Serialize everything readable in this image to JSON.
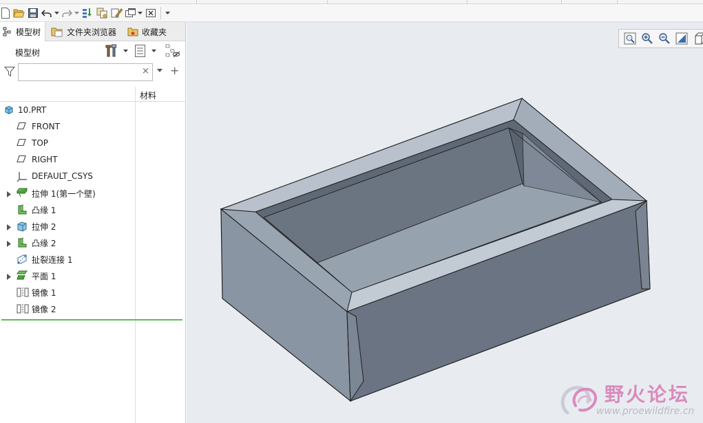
{
  "colors": {
    "accent_green": "#5cb85c",
    "model_fill": "#7f8a98",
    "model_dark": "#5d6673",
    "model_light": "#a9b3bf",
    "background": "#e8ecf0"
  },
  "toolbar": {
    "icons": [
      "new-file-icon",
      "open-folder-icon",
      "save-icon",
      "undo-icon",
      "redo-icon",
      "regenerate-icon",
      "copy-icon",
      "edit-icon",
      "window-icon",
      "close-window-icon",
      "customize-icon"
    ]
  },
  "left_panel": {
    "tabs": [
      {
        "label": "模型树",
        "icon": "model-tree-icon"
      },
      {
        "label": "文件夹浏览器",
        "icon": "folder-browser-icon"
      },
      {
        "label": "收藏夹",
        "icon": "favorites-icon"
      }
    ],
    "tree_title": "模型树",
    "search": {
      "value": "",
      "placeholder": ""
    },
    "clear_symbol": "×",
    "add_symbol": "+",
    "column_material": "材料",
    "tree_items": [
      {
        "label": "10.PRT",
        "icon": "part-icon",
        "expandable": false,
        "indent": 0
      },
      {
        "label": "FRONT",
        "icon": "datum-plane-icon",
        "expandable": false,
        "indent": 1
      },
      {
        "label": "TOP",
        "icon": "datum-plane-icon",
        "expandable": false,
        "indent": 1
      },
      {
        "label": "RIGHT",
        "icon": "datum-plane-icon",
        "expandable": false,
        "indent": 1
      },
      {
        "label": "DEFAULT_CSYS",
        "icon": "csys-icon",
        "expandable": false,
        "indent": 1
      },
      {
        "label": "拉伸 1(第一个壁)",
        "icon": "sheetmetal-extrude-icon",
        "expandable": true,
        "indent": 1
      },
      {
        "label": "凸缘 1",
        "icon": "flange-icon",
        "expandable": false,
        "indent": 1
      },
      {
        "label": "拉伸 2",
        "icon": "extrude-icon",
        "expandable": true,
        "indent": 1
      },
      {
        "label": "凸缘 2",
        "icon": "flange-icon",
        "expandable": true,
        "indent": 1
      },
      {
        "label": "扯裂连接 1",
        "icon": "rip-icon",
        "expandable": false,
        "indent": 1
      },
      {
        "label": "平面 1",
        "icon": "flat-wall-icon",
        "expandable": true,
        "indent": 1
      },
      {
        "label": "镜像 1",
        "icon": "mirror-icon",
        "expandable": false,
        "indent": 1
      },
      {
        "label": "镜像 2",
        "icon": "mirror-icon",
        "expandable": false,
        "indent": 1
      }
    ]
  },
  "view_toolbar": {
    "icons": [
      "zoom-refit-icon",
      "zoom-in-icon",
      "zoom-out-icon",
      "repaint-icon",
      "saved-views-icon"
    ]
  },
  "watermark": {
    "title": "野火论坛",
    "url": "www.proewildfire.cn"
  }
}
